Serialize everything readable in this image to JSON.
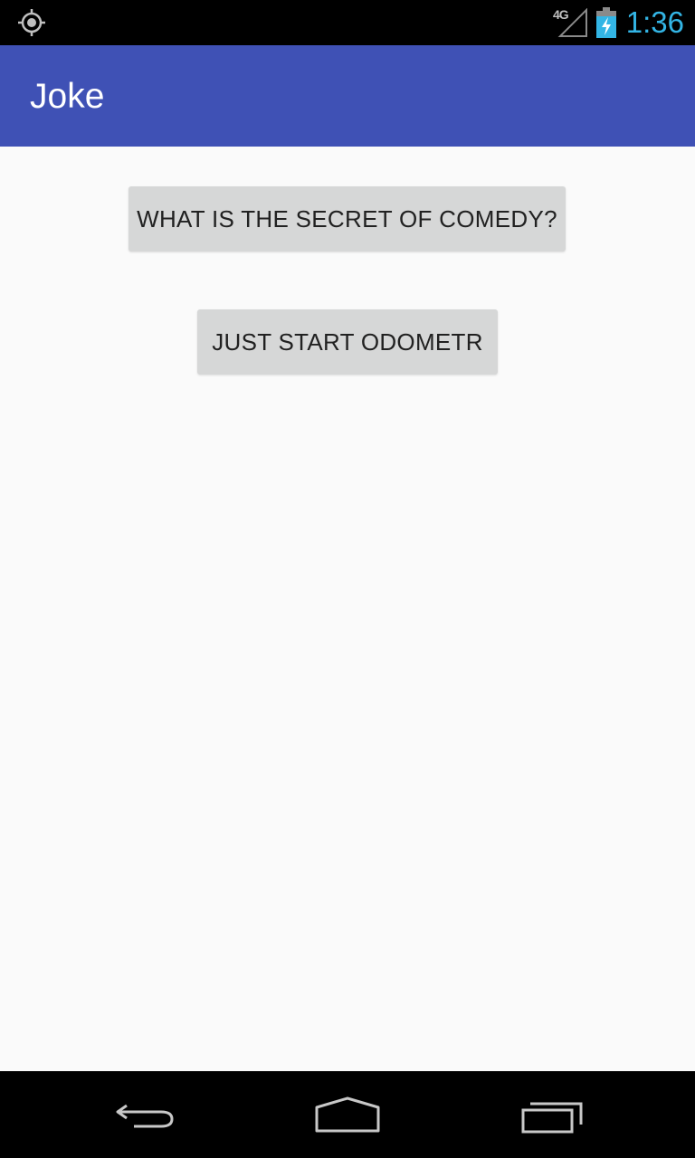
{
  "status_bar": {
    "time": "1:36",
    "network": "4G",
    "icons": [
      "gps-icon",
      "signal-icon",
      "battery-charging-icon"
    ],
    "clock_color": "#33b5e5"
  },
  "app_bar": {
    "title": "Joke",
    "color": "#3f51b5"
  },
  "main": {
    "buttons": [
      {
        "label": "WHAT IS THE SECRET OF COMEDY?"
      },
      {
        "label": "JUST START ODOMETR"
      }
    ]
  },
  "nav_bar": {
    "icons": [
      "back-icon",
      "home-icon",
      "recents-icon"
    ]
  }
}
